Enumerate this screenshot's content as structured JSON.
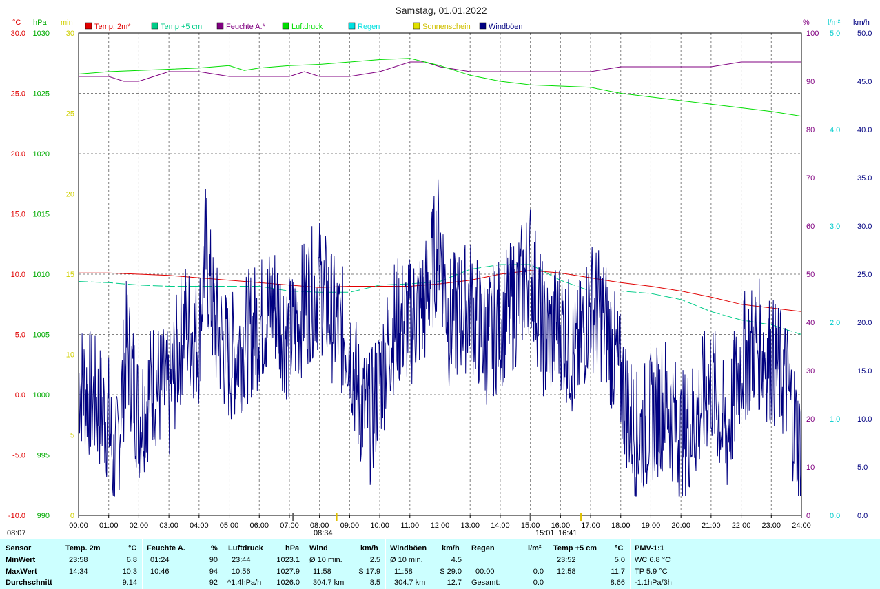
{
  "chart_data": {
    "type": "line",
    "title": "Samstag, 01.01.2022",
    "legend": [
      {
        "name": "Temp. 2m*",
        "color": "#e00000"
      },
      {
        "name": "Temp +5 cm",
        "color": "#00cc88"
      },
      {
        "name": "Feuchte A.*",
        "color": "#800080"
      },
      {
        "name": "Luftdruck",
        "color": "#00dd00"
      },
      {
        "name": "Regen",
        "color": "#00e0e0"
      },
      {
        "name": "Sonnenschein",
        "color": "#e0e000"
      },
      {
        "name": "Windböen",
        "color": "#000080"
      }
    ],
    "legend_placement": "top",
    "grid": true,
    "x_ticks": [
      "00:00",
      "01:00",
      "02:00",
      "03:00",
      "04:00",
      "05:00",
      "06:00",
      "07:00",
      "08:00",
      "09:00",
      "10:00",
      "11:00",
      "12:00",
      "13:00",
      "14:00",
      "15:00",
      "16:00",
      "17:00",
      "18:00",
      "19:00",
      "20:00",
      "21:00",
      "22:00",
      "23:00",
      "24:00"
    ],
    "axes": {
      "temp": {
        "unit": "°C",
        "range": [
          -10,
          30
        ],
        "ticks": [
          "30.0",
          "25.0",
          "20.0",
          "15.0",
          "10.0",
          "5.0",
          "0.0",
          "-5.0",
          "-10.0"
        ],
        "color": "#e00000"
      },
      "pressure": {
        "unit": "hPa",
        "range": [
          990,
          1030
        ],
        "ticks": [
          "1030",
          "1025",
          "1020",
          "1015",
          "1010",
          "1005",
          "1000",
          "995",
          "990"
        ],
        "color": "#00aa00"
      },
      "minutes": {
        "unit": "min",
        "range": [
          0,
          30
        ],
        "ticks": [
          "30",
          "25",
          "20",
          "15",
          "10",
          "5",
          "0"
        ],
        "color": "#d0d000"
      },
      "humidity": {
        "unit": "%",
        "range": [
          0,
          100
        ],
        "ticks": [
          "100",
          "90",
          "80",
          "70",
          "60",
          "50",
          "40",
          "30",
          "20",
          "10",
          "0"
        ],
        "color": "#800080"
      },
      "rain": {
        "unit": "l/m²",
        "range": [
          0,
          5
        ],
        "ticks": [
          "5.0",
          "4.0",
          "3.0",
          "2.0",
          "1.0",
          "0.0"
        ],
        "color": "#00cccc"
      },
      "wind": {
        "unit": "km/h",
        "range": [
          0,
          50
        ],
        "ticks": [
          "50.0",
          "45.0",
          "40.0",
          "35.0",
          "30.0",
          "25.0",
          "20.0",
          "15.0",
          "10.0",
          "5.0",
          "0.0"
        ],
        "color": "#000080"
      }
    },
    "series": [
      {
        "name": "Temp. 2m*",
        "axis": "temp",
        "x": [
          0,
          1,
          2,
          3,
          4,
          5,
          6,
          7,
          8,
          9,
          10,
          11,
          12,
          13,
          14,
          15,
          16,
          17,
          18,
          19,
          20,
          21,
          22,
          23,
          24
        ],
        "values": [
          10.1,
          10.1,
          10.0,
          9.9,
          9.7,
          9.5,
          9.3,
          9.1,
          8.9,
          9.0,
          9.0,
          9.0,
          9.2,
          9.5,
          10.0,
          10.3,
          10.1,
          9.7,
          9.3,
          9.0,
          8.6,
          8.1,
          7.5,
          7.2,
          6.9
        ]
      },
      {
        "name": "Temp +5 cm",
        "axis": "temp",
        "x": [
          0,
          1,
          2,
          3,
          4,
          5,
          6,
          7,
          8,
          9,
          10,
          11,
          12,
          13,
          14,
          15,
          16,
          17,
          18,
          19,
          20,
          21,
          22,
          23,
          24
        ],
        "values": [
          9.4,
          9.3,
          9.1,
          9.0,
          9.0,
          9.0,
          9.0,
          8.6,
          8.5,
          8.5,
          9.1,
          9.2,
          9.4,
          10.4,
          10.8,
          10.8,
          9.5,
          8.6,
          8.6,
          8.4,
          7.9,
          6.9,
          6.2,
          5.8,
          5.0
        ]
      },
      {
        "name": "Feuchte A.*",
        "axis": "humidity",
        "x": [
          0,
          1,
          1.5,
          2,
          2.5,
          3,
          4,
          5,
          5.5,
          6,
          7,
          7.5,
          8,
          9,
          10,
          11,
          11.5,
          12,
          13,
          13.5,
          14,
          15,
          16,
          17,
          18,
          19,
          20,
          21,
          22,
          23,
          24
        ],
        "values": [
          91,
          91,
          90,
          90,
          91,
          92,
          92,
          91,
          91,
          91,
          91,
          92,
          91,
          91,
          92,
          94,
          94,
          93,
          92,
          92,
          92,
          92,
          92,
          92,
          93,
          93,
          93,
          93,
          94,
          94,
          94
        ]
      },
      {
        "name": "Luftdruck",
        "axis": "pressure",
        "x": [
          0,
          1,
          2,
          3,
          4,
          5,
          5.5,
          6,
          7,
          8,
          9,
          10,
          11,
          11.5,
          12,
          13,
          14,
          15,
          16,
          17,
          18,
          19,
          20,
          21,
          22,
          23,
          24
        ],
        "values": [
          1026.6,
          1026.8,
          1026.9,
          1027.0,
          1027.1,
          1027.3,
          1026.9,
          1027.1,
          1027.3,
          1027.4,
          1027.6,
          1027.8,
          1027.9,
          1027.6,
          1027.3,
          1026.5,
          1026.0,
          1025.7,
          1025.6,
          1025.5,
          1025.0,
          1024.7,
          1024.4,
          1024.1,
          1023.8,
          1023.5,
          1023.1
        ]
      },
      {
        "name": "Windböen",
        "axis": "wind",
        "x": [
          0,
          0.5,
          1,
          1.2,
          1.6,
          2,
          2.5,
          3,
          3.5,
          4,
          4.2,
          4.5,
          5,
          5.5,
          6,
          6.5,
          7,
          7.5,
          8,
          8.5,
          9,
          9.3,
          9.7,
          10,
          10.5,
          11,
          11.5,
          11.97,
          12.3,
          13,
          13.5,
          14,
          14.5,
          15,
          15.5,
          16,
          16.5,
          17,
          17.5,
          18,
          18.5,
          19,
          19.5,
          20,
          20.5,
          21,
          21.5,
          22,
          22.5,
          23,
          23.5,
          24
        ],
        "values": [
          14,
          12,
          10,
          4,
          18,
          10,
          14,
          12,
          20,
          18,
          28,
          20,
          16,
          18,
          20,
          22,
          18,
          22,
          24,
          20,
          18,
          12,
          10,
          14,
          20,
          20,
          22,
          29,
          20,
          22,
          18,
          20,
          22,
          26,
          18,
          20,
          16,
          22,
          20,
          14,
          8,
          10,
          12,
          8,
          10,
          14,
          8,
          16,
          18,
          16,
          14,
          6
        ]
      }
    ],
    "rain_total": 0.0,
    "sunshine_markers": [
      "08:34",
      "16:41"
    ]
  },
  "time_markers": {
    "left": "08:07",
    "mid_a": "08:34",
    "mid_b": "15:01",
    "right": "16:41"
  },
  "stats": {
    "row_labels": [
      "Sensor",
      "MinWert",
      "MaxWert",
      "Durchschnitt"
    ],
    "temp2m": {
      "header": "Temp. 2m",
      "unit": "°C",
      "min_time": "23:58",
      "min": "6.8",
      "max_time": "14:34",
      "max": "10.3",
      "avg": "9.14"
    },
    "feuchte": {
      "header": "Feuchte A.",
      "unit": "%",
      "min_time": "01:24",
      "min": "90",
      "max_time": "10:46",
      "max": "94",
      "avg": "92"
    },
    "luftdruck": {
      "header": "Luftdruck",
      "unit": "hPa",
      "min_time": "23:44",
      "min": "1023.1",
      "max_time": "10:56",
      "max": "1027.9",
      "avg_label": "^1.4hPa/h",
      "avg": "1026.0"
    },
    "wind": {
      "header": "Wind",
      "unit": "km/h",
      "r1_label": "Ø 10 min.",
      "r1": "2.5",
      "r2_time": "11:58",
      "r2": "S 17.9",
      "r3_label": "304.7 km",
      "r3": "8.5"
    },
    "windboeen": {
      "header": "Windböen",
      "unit": "km/h",
      "r1_label": "Ø 10 min.",
      "r1": "4.5",
      "r2_time": "11:58",
      "r2": "S 29.0",
      "r3_label": "304.7 km",
      "r3": "12.7"
    },
    "regen": {
      "header": "Regen",
      "unit": "l/m²",
      "r2_time": "00:00",
      "r2": "0.0",
      "r3_label": "Gesamt:",
      "r3": "0.0"
    },
    "temp5cm": {
      "header": "Temp +5 cm",
      "unit": "°C",
      "min_time": "23:52",
      "min": "5.0",
      "max_time": "12:58",
      "max": "11.7",
      "avg": "8.66"
    },
    "pmv": {
      "header": "PMV-1:1",
      "r1": "WC 6.8 °C",
      "r2": "TP 5.9 °C",
      "r3": "-1.1hPa/3h"
    }
  }
}
